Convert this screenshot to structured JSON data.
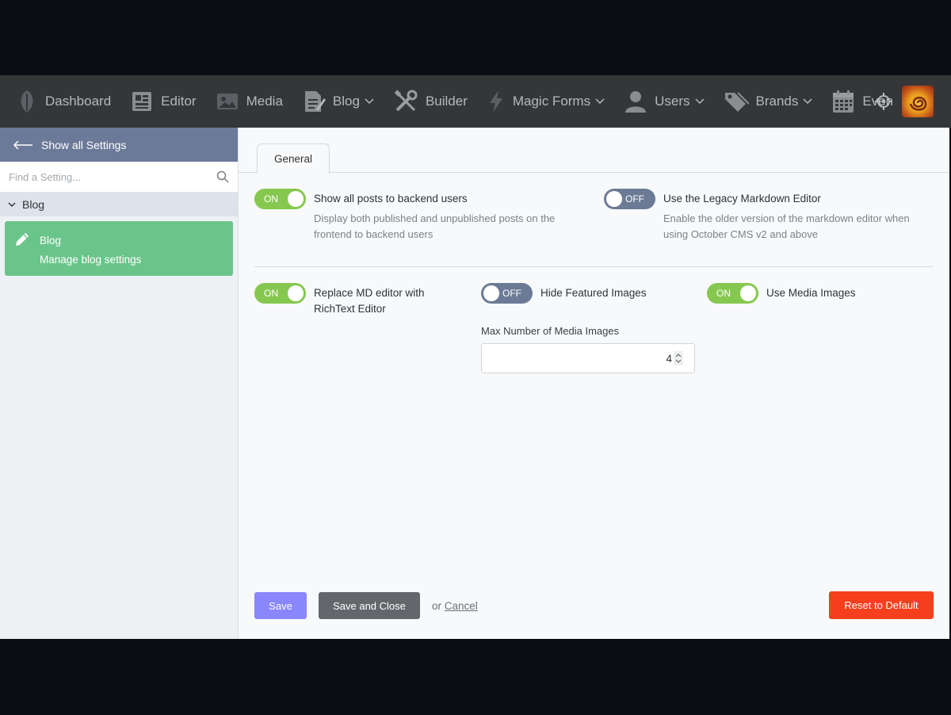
{
  "nav": {
    "items": [
      {
        "label": "Dashboard",
        "icon": "leaf-icon"
      },
      {
        "label": "Editor",
        "icon": "editor-icon"
      },
      {
        "label": "Media",
        "icon": "media-icon"
      },
      {
        "label": "Blog",
        "icon": "blog-icon",
        "dropdown": true
      },
      {
        "label": "Builder",
        "icon": "builder-icon"
      },
      {
        "label": "Magic Forms",
        "icon": "lightning-icon",
        "dropdown": true
      },
      {
        "label": "Users",
        "icon": "user-icon",
        "dropdown": true
      },
      {
        "label": "Brands",
        "icon": "tags-icon",
        "dropdown": true
      },
      {
        "label": "Even",
        "icon": "calendar-icon"
      }
    ],
    "crosshair_icon": "crosshair-icon",
    "avatar_icon": "avatar-icon"
  },
  "sidebar": {
    "back_label": "Show all Settings",
    "search_placeholder": "Find a Setting...",
    "group_label": "Blog",
    "item": {
      "title": "Blog",
      "description": "Manage blog settings"
    }
  },
  "main": {
    "tab_label": "General",
    "fields": {
      "show_all_posts": {
        "label": "Show all posts to backend users",
        "comment": "Display both published and unpublished posts on the frontend to backend users",
        "state": "ON"
      },
      "legacy_markdown": {
        "label": "Use the Legacy Markdown Editor",
        "comment": "Enable the older version of the markdown editor when using October CMS v2 and above",
        "state": "OFF"
      },
      "replace_md": {
        "label": "Replace MD editor with RichText Editor",
        "state": "ON"
      },
      "hide_featured": {
        "label": "Hide Featured Images",
        "state": "OFF"
      },
      "use_media": {
        "label": "Use Media Images",
        "state": "ON"
      }
    },
    "max_media": {
      "label": "Max Number of Media Images",
      "value": "4"
    }
  },
  "footer": {
    "save": "Save",
    "save_close": "Save and Close",
    "or": "or",
    "cancel": "Cancel",
    "reset": "Reset to Default"
  },
  "colors": {
    "topbar": "#343638",
    "sidebar_head": "#6c7a99",
    "active_item": "#6ac58a",
    "toggle_on": "#86c84f",
    "toggle_off": "#6b7b96",
    "save": "#8a86fb",
    "save_close": "#63676b",
    "reset": "#f6401d"
  }
}
